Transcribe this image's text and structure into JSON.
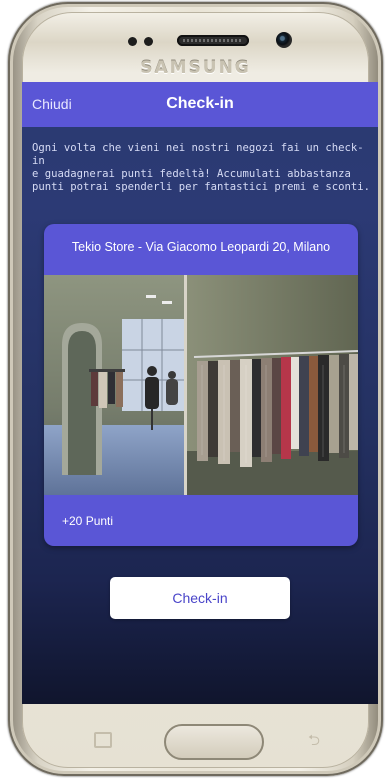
{
  "device": {
    "brand": "SAMSUNG"
  },
  "nav": {
    "close_label": "Chiudi",
    "title": "Check-in"
  },
  "intro_text": "Ogni volta che vieni nei nostri negozi fai un check-in\ne guadagnerai punti fedeltà! Accumulati abbastanza\npunti potrai spenderli per fantastici premi e sconti.",
  "store": {
    "name": "Tekio Store - Via Giacomo Leopardi 20, Milano",
    "points": "+20 Punti"
  },
  "actions": {
    "checkin_label": "Check-in"
  },
  "colors": {
    "accent": "#5a56d6",
    "screen_bg": "#2a3a70",
    "button_text": "#4a45c9"
  },
  "icons": {
    "recent": "recent-apps-icon",
    "back": "back-icon"
  }
}
